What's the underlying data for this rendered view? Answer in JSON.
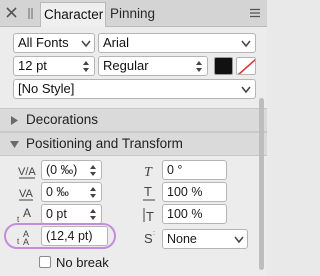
{
  "tabs": {
    "active_label": "Character",
    "inactive_label": "Pinning"
  },
  "font": {
    "collection": "All Fonts",
    "family": "Arial",
    "size": "12 pt",
    "style": "Regular"
  },
  "paragraph_style": "[No Style]",
  "sections": {
    "decorations": "Decorations",
    "positioning": "Positioning and Transform"
  },
  "positioning": {
    "tracking": "(0 ‰)",
    "kerning": "0 ‰",
    "baseline": "0 pt",
    "leading": "(12,4 pt)",
    "skew": "0 °",
    "horizontal_scale": "100 %",
    "vertical_scale": "100 %",
    "superscript_setting": "None"
  },
  "no_break_label": "No break",
  "colors": {
    "text_fill": "#111111",
    "highlight_ring": "#c58bdc",
    "no_fill_slash": "#d9383a"
  }
}
